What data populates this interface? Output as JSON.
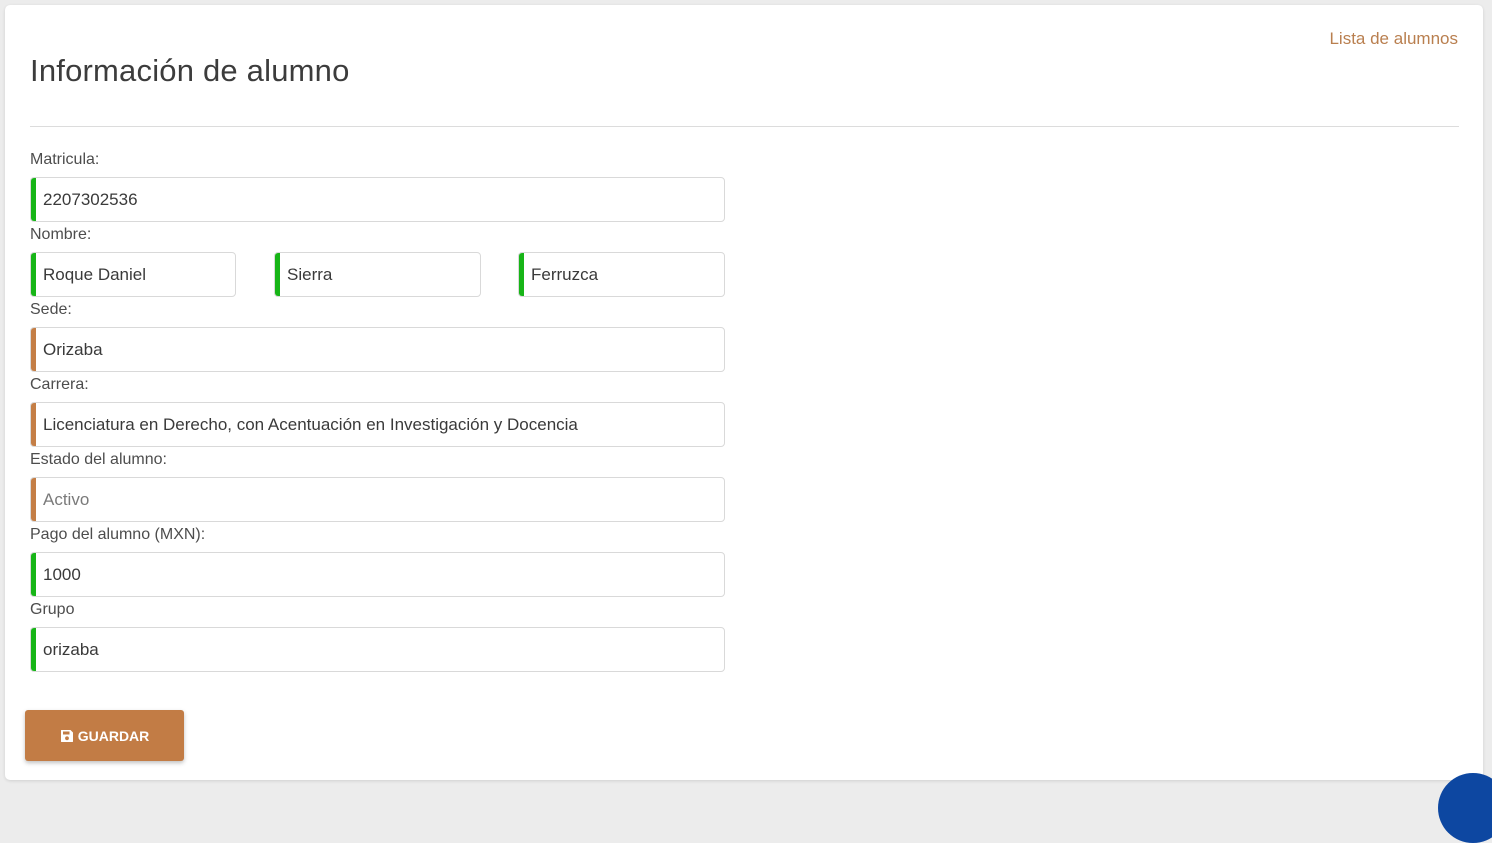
{
  "header": {
    "title": "Información de alumno",
    "list_link": "Lista de alumnos"
  },
  "form": {
    "matricula": {
      "label": "Matricula:",
      "value": "2207302536"
    },
    "nombre": {
      "label": "Nombre:",
      "first": "Roque Daniel",
      "last1": "Sierra",
      "last2": "Ferruzca"
    },
    "sede": {
      "label": "Sede:",
      "value": "Orizaba"
    },
    "carrera": {
      "label": "Carrera:",
      "value": "Licenciatura en Derecho, con Acentuación en Investigación y Docencia"
    },
    "estado": {
      "label": "Estado del alumno:",
      "value": "Activo"
    },
    "pago": {
      "label": "Pago del alumno (MXN):",
      "value": "1000"
    },
    "grupo": {
      "label": "Grupo",
      "value": "orizaba"
    }
  },
  "actions": {
    "save_label": "GUARDAR",
    "save_icon": "save-icon"
  },
  "colors": {
    "accent": "#c27c45",
    "link": "#b97f4f",
    "valid_bar": "#17b517",
    "select_bar": "#c47e46"
  }
}
